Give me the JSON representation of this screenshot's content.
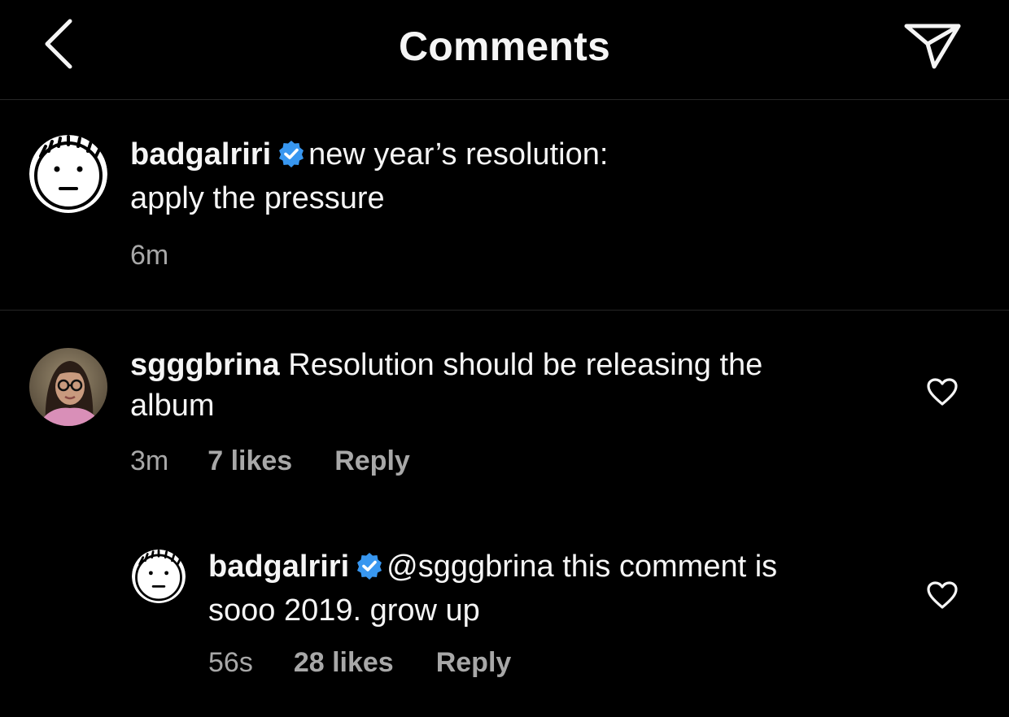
{
  "header": {
    "title": "Comments",
    "back_icon": "chevron-left-icon",
    "share_icon": "paper-plane-icon"
  },
  "caption": {
    "username": "badgalriri",
    "verified": true,
    "text_line1": "new year’s resolution:",
    "text_line2": "apply the pressure",
    "time": "6m"
  },
  "comments": [
    {
      "username": "sgggbrina",
      "text_line1": "Resolution should be releasing the",
      "text_line2": "album",
      "time": "3m",
      "likes": "7 likes",
      "reply_label": "Reply"
    }
  ],
  "replies": [
    {
      "username": "badgalriri",
      "verified": true,
      "mention": "@sgggbrina",
      "text_line1_rest": " this comment is",
      "text_line2": "sooo 2019. grow up",
      "time": "56s",
      "likes": "28 likes",
      "reply_label": "Reply"
    }
  ],
  "colors": {
    "background": "#000000",
    "text": "#f5f5f5",
    "muted": "#a8a8a8",
    "verified_blue": "#3897f0",
    "divider": "#262626"
  }
}
